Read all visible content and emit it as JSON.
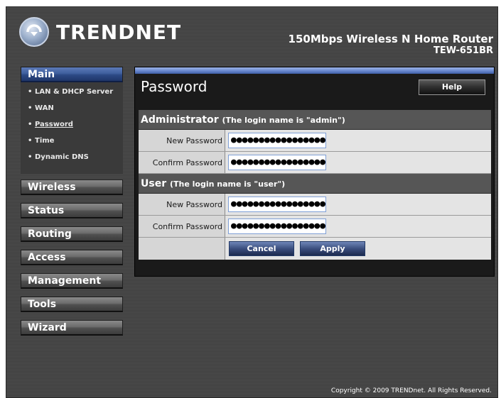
{
  "brand": {
    "name": "TRENDNET"
  },
  "header": {
    "product_line": "150Mbps Wireless N Home Router",
    "model": "TEW-651BR"
  },
  "sidebar": {
    "active": "Main",
    "sections": [
      {
        "label": "Main"
      },
      {
        "label": "Wireless"
      },
      {
        "label": "Status"
      },
      {
        "label": "Routing"
      },
      {
        "label": "Access"
      },
      {
        "label": "Management"
      },
      {
        "label": "Tools"
      },
      {
        "label": "Wizard"
      }
    ],
    "submenu": [
      {
        "label": "LAN & DHCP Server"
      },
      {
        "label": "WAN"
      },
      {
        "label": "Password"
      },
      {
        "label": "Time"
      },
      {
        "label": "Dynamic DNS"
      }
    ],
    "bullet": "•"
  },
  "main": {
    "title": "Password",
    "help_label": "Help",
    "admin": {
      "heading": "Administrator",
      "note": "(The login name is \"admin\")",
      "new_label": "New Password",
      "new_value": "●●●●●●●●●●●●●●●●●",
      "confirm_label": "Confirm Password",
      "confirm_value": "●●●●●●●●●●●●●●●●●"
    },
    "user": {
      "heading": "User",
      "note": "(The login name is \"user\")",
      "new_label": "New Password",
      "new_value": "●●●●●●●●●●●●●●●●●",
      "confirm_label": "Confirm Password",
      "confirm_value": "●●●●●●●●●●●●●●●●●"
    },
    "cancel_label": "Cancel",
    "apply_label": "Apply"
  },
  "footer": {
    "copyright": "Copyright © 2009 TRENDnet. All Rights Reserved."
  },
  "colors": {
    "active_nav": "#3f5f9e",
    "background": "#454545",
    "accent_bar": "#6d8cd1"
  }
}
